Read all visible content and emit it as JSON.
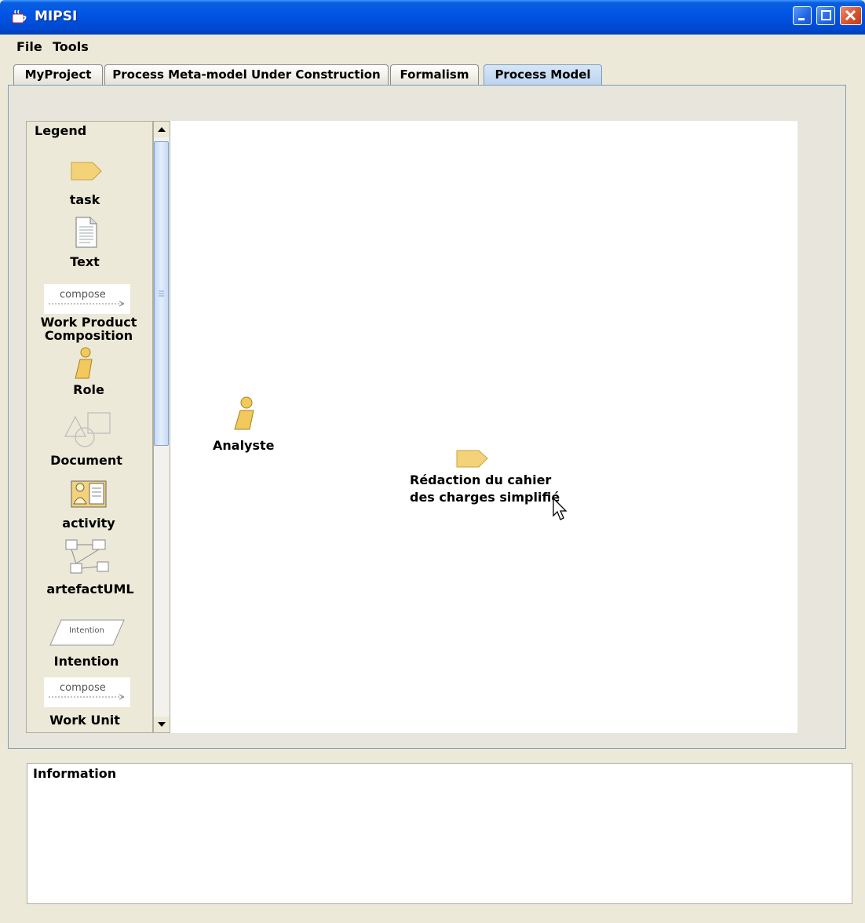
{
  "window": {
    "title": "MIPSI"
  },
  "menu": {
    "items": [
      "File",
      "Tools"
    ]
  },
  "tabs": [
    {
      "label": "MyProject",
      "active": false
    },
    {
      "label": "Process Meta-model Under Construction",
      "active": false
    },
    {
      "label": "Formalism",
      "active": false
    },
    {
      "label": "Process Model",
      "active": true
    }
  ],
  "legend": {
    "title": "Legend",
    "items": [
      {
        "label": "task",
        "icon": "task-icon"
      },
      {
        "label": "Text",
        "icon": "text-document-icon"
      },
      {
        "label": "Work Product Composition",
        "icon": "compose-arrow-icon",
        "icon_text": "compose"
      },
      {
        "label": "Role",
        "icon": "role-person-icon"
      },
      {
        "label": "Document",
        "icon": "document-shapes-icon"
      },
      {
        "label": "activity",
        "icon": "activity-icon"
      },
      {
        "label": "artefactUML",
        "icon": "uml-diagram-icon"
      },
      {
        "label": "Intention",
        "icon": "intention-parallelogram-icon",
        "icon_text": "Intention"
      },
      {
        "label": "Work Unit",
        "icon": "compose-arrow-icon",
        "icon_text": "compose"
      }
    ]
  },
  "canvas": {
    "nodes": [
      {
        "type": "role",
        "label": "Analyste"
      },
      {
        "type": "task",
        "label_line1": "Rédaction du cahier",
        "label_line2": "des charges simplifié"
      }
    ]
  },
  "information": {
    "title": "Information"
  },
  "colors": {
    "titlebar": "#0055e5",
    "task_fill": "#f3d27a",
    "role_fill": "#f2c95c",
    "active_tab": "#bcd3ef"
  }
}
